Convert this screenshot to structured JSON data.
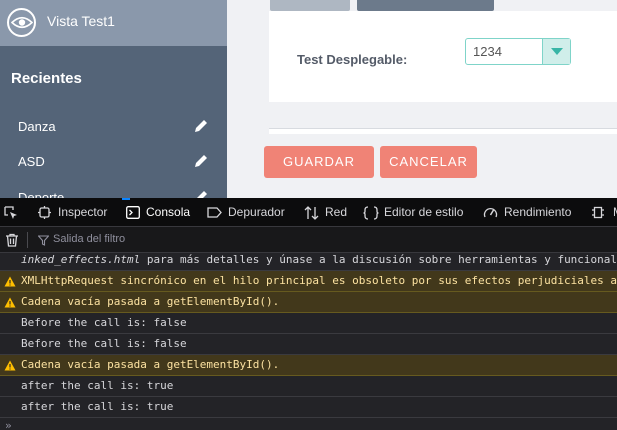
{
  "app": {
    "title": "Vista Test1",
    "sidebar": {
      "section_title": "Recientes",
      "items": [
        {
          "label": "Danza"
        },
        {
          "label": "ASD"
        },
        {
          "label": "Deporte"
        }
      ]
    },
    "form": {
      "field_label": "Test Desplegable:",
      "select_value": "1234"
    },
    "buttons": {
      "save": "GUARDAR",
      "cancel": "CANCELAR"
    },
    "colors": {
      "sidebar": "#546478",
      "accent_button": "#f08376",
      "select_border": "#7fd4c9"
    }
  },
  "devtools": {
    "tabs": [
      {
        "label": "Inspector",
        "icon": "inspector-icon"
      },
      {
        "label": "Consola",
        "icon": "console-icon",
        "active": true
      },
      {
        "label": "Depurador",
        "icon": "debugger-icon"
      },
      {
        "label": "Red",
        "icon": "network-icon"
      },
      {
        "label": "Editor de estilo",
        "icon": "style-editor-icon"
      },
      {
        "label": "Rendimiento",
        "icon": "performance-icon"
      },
      {
        "label": "M",
        "icon": "memory-icon"
      }
    ],
    "filter_placeholder": "Salida del filtro",
    "messages": [
      {
        "type": "plain",
        "text": "inked_effects.html para más detalles y únase a la discusión sobre herramientas y funcionalidades",
        "italic_prefix": true
      },
      {
        "type": "warn",
        "text": "XMLHttpRequest sincrónico en el hilo principal es obsoleto por sus efectos perjudiciales a"
      },
      {
        "type": "warn",
        "text": "Cadena vacía pasada a getElementById()."
      },
      {
        "type": "plain",
        "text": "Before the call is: false"
      },
      {
        "type": "plain",
        "text": "Before the call is: false"
      },
      {
        "type": "warn",
        "text": "Cadena vacía pasada a getElementById()."
      },
      {
        "type": "plain",
        "text": "after the call is: true"
      },
      {
        "type": "plain",
        "text": "after the call is: true"
      }
    ],
    "prompt": "»"
  }
}
